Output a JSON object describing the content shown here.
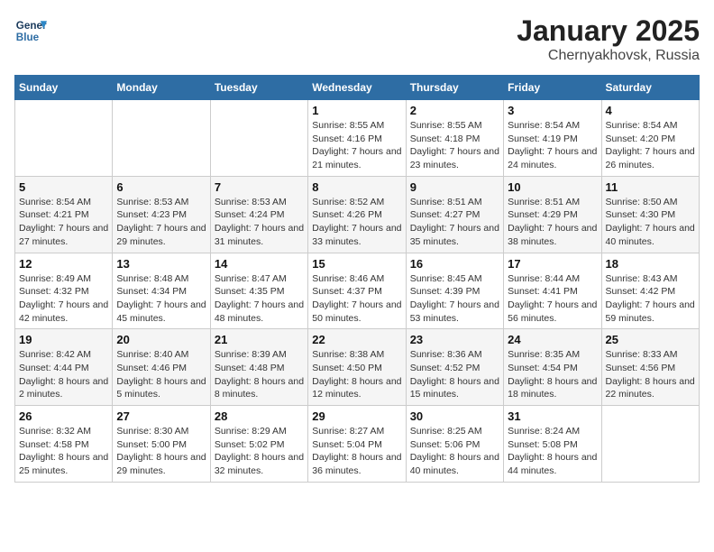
{
  "header": {
    "logo_line1": "General",
    "logo_line2": "Blue",
    "month": "January 2025",
    "location": "Chernyakhovsk, Russia"
  },
  "weekdays": [
    "Sunday",
    "Monday",
    "Tuesday",
    "Wednesday",
    "Thursday",
    "Friday",
    "Saturday"
  ],
  "weeks": [
    [
      {
        "day": "",
        "sunrise": "",
        "sunset": "",
        "daylight": ""
      },
      {
        "day": "",
        "sunrise": "",
        "sunset": "",
        "daylight": ""
      },
      {
        "day": "",
        "sunrise": "",
        "sunset": "",
        "daylight": ""
      },
      {
        "day": "1",
        "sunrise": "Sunrise: 8:55 AM",
        "sunset": "Sunset: 4:16 PM",
        "daylight": "Daylight: 7 hours and 21 minutes."
      },
      {
        "day": "2",
        "sunrise": "Sunrise: 8:55 AM",
        "sunset": "Sunset: 4:18 PM",
        "daylight": "Daylight: 7 hours and 23 minutes."
      },
      {
        "day": "3",
        "sunrise": "Sunrise: 8:54 AM",
        "sunset": "Sunset: 4:19 PM",
        "daylight": "Daylight: 7 hours and 24 minutes."
      },
      {
        "day": "4",
        "sunrise": "Sunrise: 8:54 AM",
        "sunset": "Sunset: 4:20 PM",
        "daylight": "Daylight: 7 hours and 26 minutes."
      }
    ],
    [
      {
        "day": "5",
        "sunrise": "Sunrise: 8:54 AM",
        "sunset": "Sunset: 4:21 PM",
        "daylight": "Daylight: 7 hours and 27 minutes."
      },
      {
        "day": "6",
        "sunrise": "Sunrise: 8:53 AM",
        "sunset": "Sunset: 4:23 PM",
        "daylight": "Daylight: 7 hours and 29 minutes."
      },
      {
        "day": "7",
        "sunrise": "Sunrise: 8:53 AM",
        "sunset": "Sunset: 4:24 PM",
        "daylight": "Daylight: 7 hours and 31 minutes."
      },
      {
        "day": "8",
        "sunrise": "Sunrise: 8:52 AM",
        "sunset": "Sunset: 4:26 PM",
        "daylight": "Daylight: 7 hours and 33 minutes."
      },
      {
        "day": "9",
        "sunrise": "Sunrise: 8:51 AM",
        "sunset": "Sunset: 4:27 PM",
        "daylight": "Daylight: 7 hours and 35 minutes."
      },
      {
        "day": "10",
        "sunrise": "Sunrise: 8:51 AM",
        "sunset": "Sunset: 4:29 PM",
        "daylight": "Daylight: 7 hours and 38 minutes."
      },
      {
        "day": "11",
        "sunrise": "Sunrise: 8:50 AM",
        "sunset": "Sunset: 4:30 PM",
        "daylight": "Daylight: 7 hours and 40 minutes."
      }
    ],
    [
      {
        "day": "12",
        "sunrise": "Sunrise: 8:49 AM",
        "sunset": "Sunset: 4:32 PM",
        "daylight": "Daylight: 7 hours and 42 minutes."
      },
      {
        "day": "13",
        "sunrise": "Sunrise: 8:48 AM",
        "sunset": "Sunset: 4:34 PM",
        "daylight": "Daylight: 7 hours and 45 minutes."
      },
      {
        "day": "14",
        "sunrise": "Sunrise: 8:47 AM",
        "sunset": "Sunset: 4:35 PM",
        "daylight": "Daylight: 7 hours and 48 minutes."
      },
      {
        "day": "15",
        "sunrise": "Sunrise: 8:46 AM",
        "sunset": "Sunset: 4:37 PM",
        "daylight": "Daylight: 7 hours and 50 minutes."
      },
      {
        "day": "16",
        "sunrise": "Sunrise: 8:45 AM",
        "sunset": "Sunset: 4:39 PM",
        "daylight": "Daylight: 7 hours and 53 minutes."
      },
      {
        "day": "17",
        "sunrise": "Sunrise: 8:44 AM",
        "sunset": "Sunset: 4:41 PM",
        "daylight": "Daylight: 7 hours and 56 minutes."
      },
      {
        "day": "18",
        "sunrise": "Sunrise: 8:43 AM",
        "sunset": "Sunset: 4:42 PM",
        "daylight": "Daylight: 7 hours and 59 minutes."
      }
    ],
    [
      {
        "day": "19",
        "sunrise": "Sunrise: 8:42 AM",
        "sunset": "Sunset: 4:44 PM",
        "daylight": "Daylight: 8 hours and 2 minutes."
      },
      {
        "day": "20",
        "sunrise": "Sunrise: 8:40 AM",
        "sunset": "Sunset: 4:46 PM",
        "daylight": "Daylight: 8 hours and 5 minutes."
      },
      {
        "day": "21",
        "sunrise": "Sunrise: 8:39 AM",
        "sunset": "Sunset: 4:48 PM",
        "daylight": "Daylight: 8 hours and 8 minutes."
      },
      {
        "day": "22",
        "sunrise": "Sunrise: 8:38 AM",
        "sunset": "Sunset: 4:50 PM",
        "daylight": "Daylight: 8 hours and 12 minutes."
      },
      {
        "day": "23",
        "sunrise": "Sunrise: 8:36 AM",
        "sunset": "Sunset: 4:52 PM",
        "daylight": "Daylight: 8 hours and 15 minutes."
      },
      {
        "day": "24",
        "sunrise": "Sunrise: 8:35 AM",
        "sunset": "Sunset: 4:54 PM",
        "daylight": "Daylight: 8 hours and 18 minutes."
      },
      {
        "day": "25",
        "sunrise": "Sunrise: 8:33 AM",
        "sunset": "Sunset: 4:56 PM",
        "daylight": "Daylight: 8 hours and 22 minutes."
      }
    ],
    [
      {
        "day": "26",
        "sunrise": "Sunrise: 8:32 AM",
        "sunset": "Sunset: 4:58 PM",
        "daylight": "Daylight: 8 hours and 25 minutes."
      },
      {
        "day": "27",
        "sunrise": "Sunrise: 8:30 AM",
        "sunset": "Sunset: 5:00 PM",
        "daylight": "Daylight: 8 hours and 29 minutes."
      },
      {
        "day": "28",
        "sunrise": "Sunrise: 8:29 AM",
        "sunset": "Sunset: 5:02 PM",
        "daylight": "Daylight: 8 hours and 32 minutes."
      },
      {
        "day": "29",
        "sunrise": "Sunrise: 8:27 AM",
        "sunset": "Sunset: 5:04 PM",
        "daylight": "Daylight: 8 hours and 36 minutes."
      },
      {
        "day": "30",
        "sunrise": "Sunrise: 8:25 AM",
        "sunset": "Sunset: 5:06 PM",
        "daylight": "Daylight: 8 hours and 40 minutes."
      },
      {
        "day": "31",
        "sunrise": "Sunrise: 8:24 AM",
        "sunset": "Sunset: 5:08 PM",
        "daylight": "Daylight: 8 hours and 44 minutes."
      },
      {
        "day": "",
        "sunrise": "",
        "sunset": "",
        "daylight": ""
      }
    ]
  ]
}
